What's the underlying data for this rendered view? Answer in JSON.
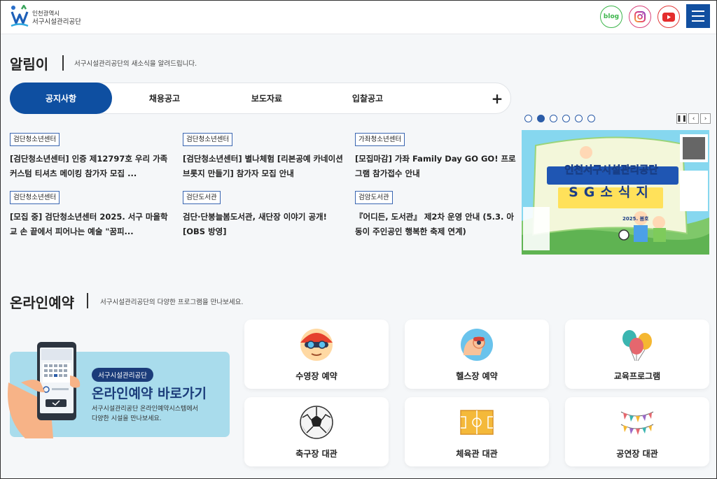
{
  "header": {
    "logo_line1": "인천광역시",
    "logo_line2": "서구시설관리공단",
    "blog_label": "blog",
    "brand_color": "#114fa0"
  },
  "notice_section": {
    "title": "알림이",
    "subtitle": "서구시설관리공단의 새소식을 알려드립니다.",
    "tabs": [
      {
        "label": "공지사항",
        "active": true
      },
      {
        "label": "채용공고",
        "active": false
      },
      {
        "label": "보도자료",
        "active": false
      },
      {
        "label": "입찰공고",
        "active": false
      }
    ],
    "more_label": "+",
    "items": [
      {
        "badge": "검단청소년센터",
        "title": "[검단청소년센터] 인증 제12797호 우리 가족 커스텀 티셔츠 메이킹 참가자 모집 ..."
      },
      {
        "badge": "검단청소년센터",
        "title": "[검단청소년센터] 별나체험 [리본공예 카네이션 브롯지 만들기] 참가자 모집 안내"
      },
      {
        "badge": "가좌청소년센터",
        "title": "[모집마감] 가좌 Family Day GO GO! 프로그램 참가접수 안내"
      },
      {
        "badge": "검단청소년센터",
        "title": "[모집 중] 검단청소년센터 2025. 서구 마을학교 손 끝에서 피어나는 예술 \"꿈피..."
      },
      {
        "badge": "검단도서관",
        "title": "검단·단봉늘봄도서관, 새단장 이야기 공개! [OBS 방영]"
      },
      {
        "badge": "검암도서관",
        "title": "『어디든, 도서관』 제2차 운영 안내 (5.3. 아동이 주인공인 행복한 축제 연계)"
      }
    ]
  },
  "slider": {
    "total_slides": 6,
    "active_index": 1,
    "banner_title": "인천서구시설관리공단",
    "banner_subtitle": "SG소식지",
    "banner_date": "2025. 봄호"
  },
  "reservation_section": {
    "title": "온라인예약",
    "subtitle": "서구시설관리공단의 다양한 프로그램을 만나보세요.",
    "banner": {
      "pill": "서구시설관리공단",
      "title": "온라인예약 바로가기",
      "desc_line1": "서구시설관리공단 온라인예약시스템에서",
      "desc_line2": "다양한 시설을 만나보세요."
    },
    "cards": [
      {
        "label": "수영장 예약",
        "icon": "swimming-icon"
      },
      {
        "label": "헬스장 예약",
        "icon": "fitness-icon"
      },
      {
        "label": "교육프로그램",
        "icon": "balloons-icon"
      },
      {
        "label": "축구장 대관",
        "icon": "soccer-ball-icon"
      },
      {
        "label": "체육관 대관",
        "icon": "gym-court-icon"
      },
      {
        "label": "공연장 대관",
        "icon": "bunting-icon"
      }
    ]
  }
}
